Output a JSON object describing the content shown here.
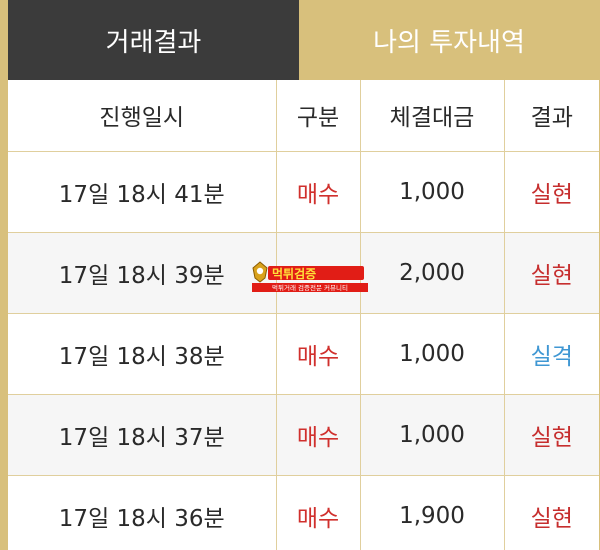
{
  "tabs": {
    "results": "거래결과",
    "mine": "나의 투자내역"
  },
  "table": {
    "headers": [
      "진행일시",
      "구분",
      "체결대금",
      "결과"
    ],
    "rows": [
      {
        "datetime": "17일 18시 41분",
        "type": "매수",
        "amount": "1,000",
        "result": "실현",
        "result_kind": "win"
      },
      {
        "datetime": "17일 18시 39분",
        "type": "",
        "amount": "2,000",
        "result": "실현",
        "result_kind": "win"
      },
      {
        "datetime": "17일 18시 38분",
        "type": "매수",
        "amount": "1,000",
        "result": "실격",
        "result_kind": "lose"
      },
      {
        "datetime": "17일 18시 37분",
        "type": "매수",
        "amount": "1,000",
        "result": "실현",
        "result_kind": "win"
      },
      {
        "datetime": "17일 18시 36분",
        "type": "매수",
        "amount": "1,900",
        "result": "실현",
        "result_kind": "win"
      }
    ]
  },
  "watermark": {
    "logo_text": "먹튀검증",
    "tagline": "먹튀거래 검증전문 커뮤니티"
  },
  "colors": {
    "gold": "#d8c07c",
    "dark_tab": "#3b3b3b",
    "buy_red": "#d0302d",
    "win_red": "#c62e2e",
    "lose_blue": "#3f97d3"
  }
}
